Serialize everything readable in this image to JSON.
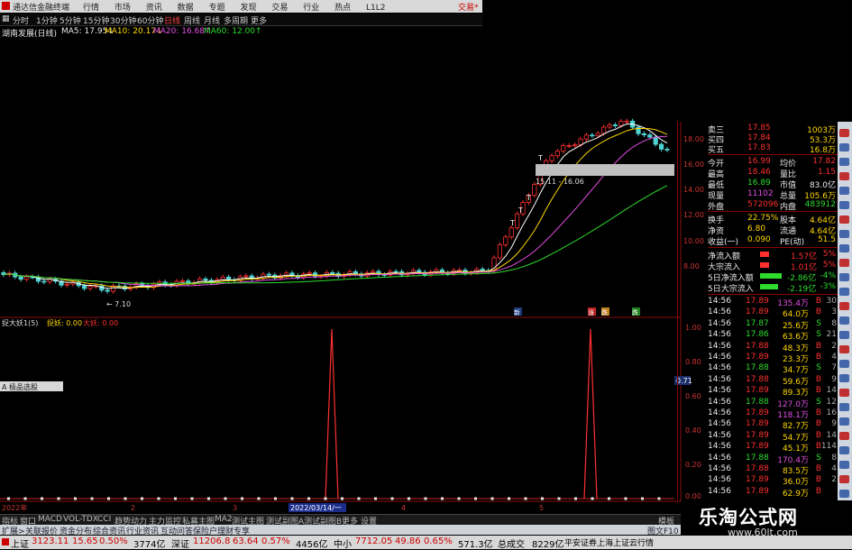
{
  "titlebar": {
    "app_name": "通达信金融终端",
    "menu": [
      "行情",
      "市场",
      "资讯",
      "数据",
      "专题",
      "发现",
      "交易",
      "行业",
      "热点",
      "L1L2"
    ],
    "right_label": "交易*"
  },
  "periods": [
    "分时",
    "1分钟",
    "5分钟",
    "15分钟",
    "30分钟",
    "60分钟",
    "日线",
    "周线",
    "月线",
    "多周期",
    "更多"
  ],
  "ma_info": {
    "stock": "湖南发展(日线)",
    "ma5": "MA5: 17.95↓",
    "ma10": "MA10: 20.17↓",
    "ma20": "MA20: 16.68↑",
    "ma60": "MA60: 12.00↑"
  },
  "price_axis": [
    "18.00",
    "16.00",
    "14.00",
    "12.00",
    "10.00",
    "8.00"
  ],
  "indicator_axis": [
    "1.00",
    "0.80",
    "0.60",
    "0.40",
    "0.20",
    "0.00"
  ],
  "indicator_header": {
    "name": "捉大妖1(5)",
    "l1": "捉妖: 0.00",
    "l2": "大妖: 0.00"
  },
  "toolbar_btn": "A 极品选股",
  "current_value": "0.71",
  "annotations": {
    "low_price": "← 7.10",
    "range_label": "15.11 - 16.06",
    "markers": [
      "T",
      "T",
      "T",
      "T"
    ],
    "events": [
      "新",
      "涨",
      "跌",
      "跌"
    ]
  },
  "x_axis": {
    "labels": [
      "2022年",
      "2",
      "3",
      "4",
      "5"
    ],
    "cursor_date": "2022/03/14/一"
  },
  "quote_top": [
    {
      "label": "卖三",
      "price": "17.85",
      "vol": "1003万"
    },
    {
      "label": "买四",
      "price": "17.84",
      "vol": "53.3万"
    },
    {
      "label": "买五",
      "price": "17.83",
      "vol": "16.8万"
    }
  ],
  "quote_rows": [
    {
      "k1": "今开",
      "v1": "16.99",
      "k2": "均价",
      "v2": "17.82"
    },
    {
      "k1": "最高",
      "v1": "18.46",
      "k2": "量比",
      "v2": "1.15"
    },
    {
      "k1": "最低",
      "v1": "16.89",
      "k2": "市值",
      "v2": "83.0亿"
    },
    {
      "k1": "现量",
      "v1": "11102",
      "k2": "总量",
      "v2": "105.6万"
    },
    {
      "k1": "外盘",
      "v1": "572096",
      "k2": "内盘",
      "v2": "483912"
    },
    {
      "k1": "换手",
      "v1": "22.75%",
      "k2": "股本",
      "v2": "4.64亿"
    },
    {
      "k1": "净资",
      "v1": "6.80",
      "k2": "流通",
      "v2": "4.64亿"
    },
    {
      "k1": "收益(一)",
      "v1": "0.090",
      "k2": "PE(动)",
      "v2": "51.5"
    }
  ],
  "flows": [
    {
      "label": "净流入额",
      "value": "1.57亿",
      "pct": "5%"
    },
    {
      "label": "大宗流入",
      "value": "1.01亿",
      "pct": "5%"
    },
    {
      "label": "5日净流入额",
      "value": "-2.86亿",
      "pct": "-4%"
    },
    {
      "label": "5日大宗流入",
      "value": "-2.19亿",
      "pct": "-3%"
    }
  ],
  "ticks": [
    {
      "t": "14:56",
      "p": "17.89",
      "v": "135.4万",
      "s": "B"
    },
    {
      "t": "14:56",
      "p": "17.89",
      "v": "64.0万",
      "s": "B"
    },
    {
      "t": "14:56",
      "p": "17.87",
      "v": "25.6万",
      "s": "S"
    },
    {
      "t": "14:56",
      "p": "17.86",
      "v": "63.6万",
      "s": "S"
    },
    {
      "t": "14:56",
      "p": "17.88",
      "v": "48.3万",
      "s": "B"
    },
    {
      "t": "14:56",
      "p": "17.89",
      "v": "23.3万",
      "s": "B"
    },
    {
      "t": "14:56",
      "p": "17.88",
      "v": "34.7万",
      "s": "S"
    },
    {
      "t": "14:56",
      "p": "17.88",
      "v": "59.6万",
      "s": "B"
    },
    {
      "t": "14:56",
      "p": "17.89",
      "v": "89.3万",
      "s": "B"
    },
    {
      "t": "14:56",
      "p": "17.88",
      "v": "127.0万",
      "s": "S"
    },
    {
      "t": "14:56",
      "p": "17.89",
      "v": "118.1万",
      "s": "B"
    },
    {
      "t": "14:56",
      "p": "17.89",
      "v": "82.7万",
      "s": "B"
    },
    {
      "t": "14:56",
      "p": "17.89",
      "v": "54.7万",
      "s": "B"
    },
    {
      "t": "14:56",
      "p": "17.89",
      "v": "45.1万",
      "s": "B"
    },
    {
      "t": "14:56",
      "p": "17.88",
      "v": "170.4万",
      "s": "S"
    },
    {
      "t": "14:56",
      "p": "17.88",
      "v": "83.5万",
      "s": "B"
    },
    {
      "t": "14:56",
      "p": "17.89",
      "v": "36.0万",
      "s": "B"
    },
    {
      "t": "14:56",
      "p": "17.89",
      "v": "62.9万",
      "s": "B"
    }
  ],
  "tick_counts": [
    "30",
    "3",
    "8",
    "21",
    "2",
    "4",
    "7",
    "9",
    "14",
    "12",
    "16",
    "9",
    "14",
    "114",
    "8",
    "4",
    "2"
  ],
  "bottom_tabs": [
    "指标",
    "窗口",
    "MACD",
    "VOL-TDX",
    "CCI",
    "趋势动力",
    "主力监控",
    "私募主图",
    "MA2",
    "测试主图",
    "测试副图A",
    "测试副图B",
    "更多",
    "设置"
  ],
  "bottom_right": "模板",
  "info_tabs": [
    "扩展>",
    "关联报价",
    "资金分布",
    "综合资讯",
    "行业资讯",
    "互动问答",
    "保险户理财专享"
  ],
  "info_right": "图文F10",
  "status": {
    "sh_label": "上证",
    "sh": "3123.11",
    "sh_chg": "15.65",
    "sh_pct": "0.50%",
    "sh_amt": "3774亿",
    "sz_label": "深证",
    "sz": "11206.8",
    "sz_chg": "63.64",
    "sz_pct": "0.57%",
    "sz_amt": "4456亿",
    "zx_label": "中小",
    "zx": "7712.05",
    "zx_chg": "49.86",
    "zx_pct": "0.65%",
    "zx_amt": "571.3亿",
    "total_label": "总成交",
    "total": "8229亿",
    "broker": "平安证券上海上证云行情"
  },
  "watermark": {
    "title": "乐淘公式网",
    "url": "www.60lt.com"
  },
  "colors": {
    "up": "#ff3030",
    "down": "#2ddc2d",
    "ma5": "#ffffff",
    "ma10": "#ffd700",
    "ma20": "#e24fe2",
    "ma60": "#2ddc2d",
    "signal": "#ff3030"
  },
  "chart_data": {
    "type": "candlestick+indicator",
    "price_ylim": [
      7,
      19
    ],
    "ma_last": {
      "MA5": 17.95,
      "MA10": 20.17,
      "MA20": 16.68,
      "MA60": 12.0
    },
    "indicator_ylim": [
      0,
      1
    ],
    "indicator_spikes": [
      {
        "date": "2022/03/14",
        "value": 1.0
      },
      {
        "date": "2022/04",
        "value": 1.0
      }
    ]
  }
}
